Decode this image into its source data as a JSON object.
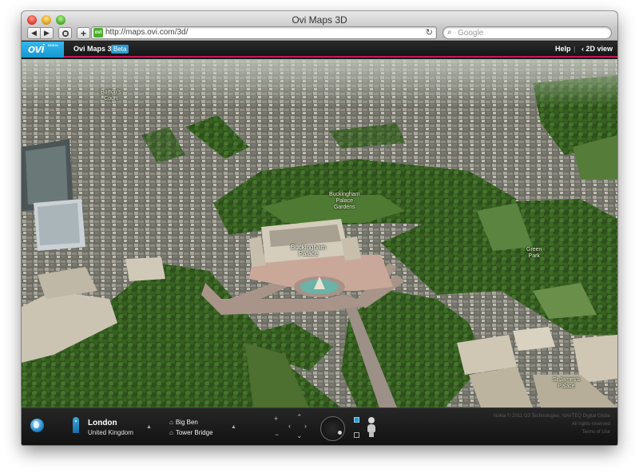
{
  "window": {
    "title": "Ovi Maps 3D"
  },
  "toolbar": {
    "back_glyph": "◀",
    "forward_glyph": "▶",
    "add_glyph": "+",
    "url": "http://maps.ovi.com/3d/",
    "favicon_text": "ovi",
    "search_placeholder": "Google"
  },
  "header": {
    "logo": "ovi",
    "logo_sub": "NOKIA",
    "app_title": "Ovi Maps 3D",
    "beta": "Beta",
    "help": "Help",
    "separator": "|",
    "view_2d": "‹ 2D view"
  },
  "map": {
    "labels": {
      "burton_court": "Burton's\nCourt",
      "palace_gardens": "Buckingham\nPalace\nGardens",
      "palace": "Buckingham\nPalace",
      "green_park": "Green\nPark",
      "st_james_palace": "St James's\nPalace"
    }
  },
  "bottom": {
    "city": "London",
    "country": "United Kingdom",
    "pois": [
      "Big Ben",
      "Tower Bridge"
    ],
    "copyright_lines": [
      "Nokia © 2011 G3 Technologies, NAVTEQ Digital Globe",
      "All rights reserved",
      "Terms of Use"
    ]
  },
  "colors": {
    "brand_blue": "#1598d0",
    "accent_pink": "#c2185b",
    "park_green": "#2f5a1e"
  }
}
